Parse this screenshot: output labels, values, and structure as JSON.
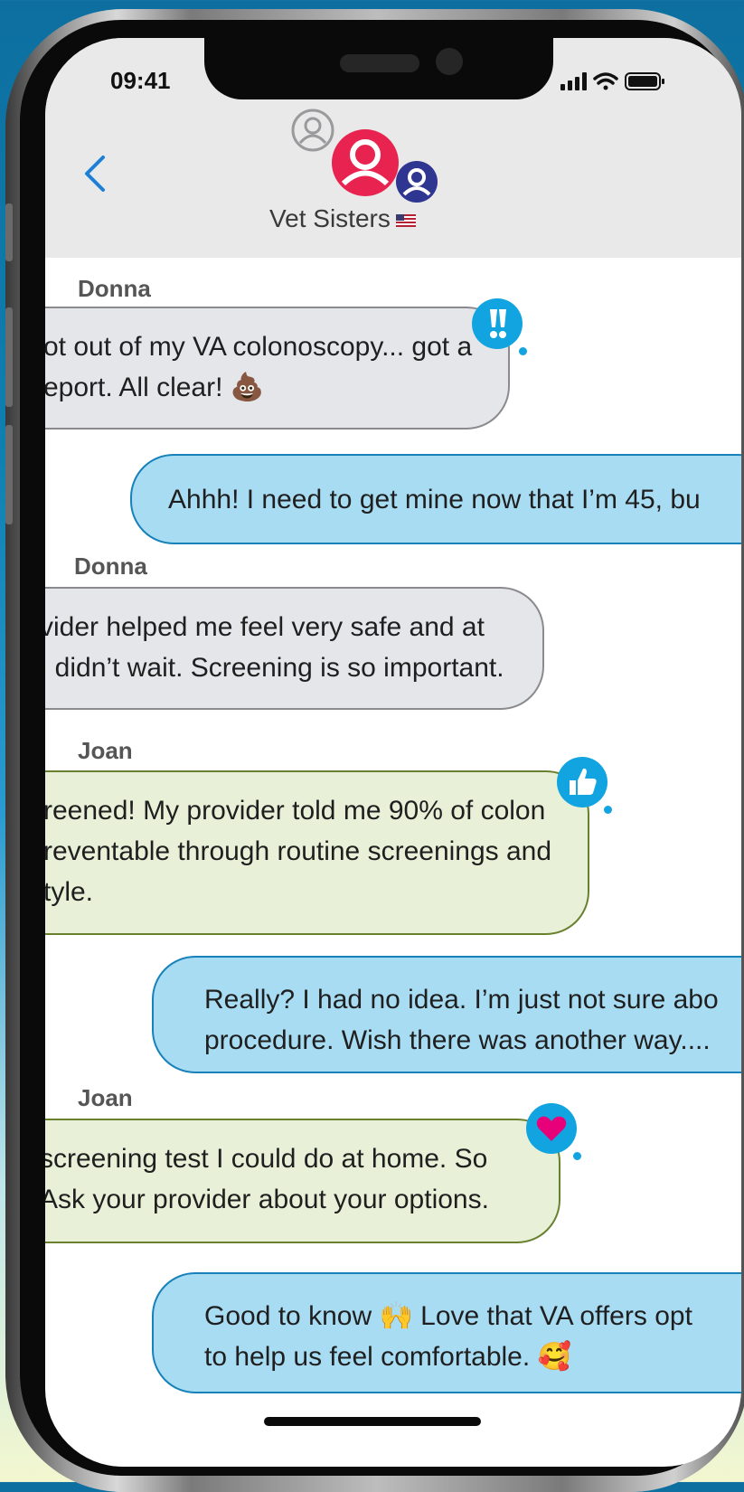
{
  "status_bar": {
    "time": "09:41"
  },
  "header": {
    "title": "Vet Sisters",
    "flag_emoji": "🇺🇸"
  },
  "icons": {
    "back": "chevron-left-icon",
    "avatars": [
      "person-icon-gray",
      "person-icon-pink",
      "person-icon-navy"
    ],
    "tapbacks": [
      "exclamation-icon",
      "thumbs-up-icon",
      "heart-icon"
    ]
  },
  "colors": {
    "incoming_gray": "#e5e6ea",
    "outgoing_blue": "#a7dcf3",
    "incoming_green": "#e8f1d8",
    "tapback": "#12a4e0",
    "avatar_pink": "#e8234f",
    "avatar_navy": "#2f3691"
  },
  "messages": [
    {
      "sender": "Donna",
      "lines": [
        "ot out of my VA colonoscopy... got a",
        "eport. All clear! 💩"
      ],
      "tapback": "!!"
    },
    {
      "sender": "",
      "lines": [
        "Ahhh! I need to get mine now that I’m 45, bu"
      ]
    },
    {
      "sender": "Donna",
      "lines": [
        "vider helped me feel very safe and at",
        "I didn’t wait. Screening is so important."
      ]
    },
    {
      "sender": "Joan",
      "lines": [
        "reened! My provider told me 90% of colon",
        "reventable through routine screenings and",
        "tyle."
      ],
      "tapback": "thumbs-up"
    },
    {
      "sender": "",
      "lines": [
        "Really? I had no idea. I’m just not sure abo",
        "procedure. Wish there was another way...."
      ]
    },
    {
      "sender": "Joan",
      "lines": [
        "screening test I could do at home. So",
        "Ask your provider about your options."
      ],
      "tapback": "heart"
    },
    {
      "sender": "",
      "lines": [
        "Good to know 🙌 Love that VA offers opt",
        "to help us feel comfortable. 🥰"
      ]
    }
  ]
}
